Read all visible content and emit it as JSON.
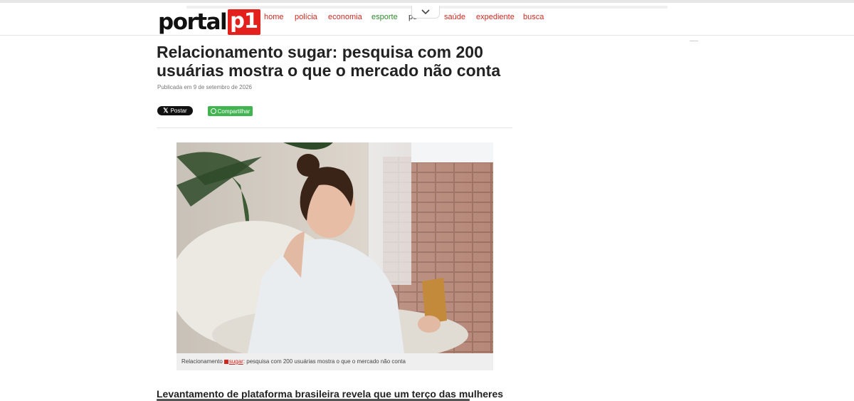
{
  "logo": {
    "text": "portal",
    "box": "p1"
  },
  "nav": {
    "home": "home",
    "policia": "polícia",
    "economia": "economia",
    "esporte": "esporte",
    "politica": "po",
    "saude": "saúde",
    "expediente": "expediente",
    "busca": "busca"
  },
  "article": {
    "headline": "Relacionamento sugar: pesquisa com 200 usuárias mostra o que o mercado não conta",
    "pubdate": "Publicada em 9 de setembro de 2026",
    "share_x": "Postar",
    "share_wa": "Compartilhar",
    "caption_pre": "Relacionamento",
    "caption_tag": "sugar",
    "caption_post": ": pesquisa com 200 usuárias mostra o que o mercado não conta",
    "lede": "Levantamento de plataforma brasileira revela que um terço das mulheres"
  },
  "colors": {
    "brand_red": "#e3201b",
    "link_red": "#d4261f",
    "esporte_green": "#2e8b2e",
    "whatsapp_green": "#3fb44f"
  },
  "icons": [
    "x-logo-icon",
    "whatsapp-icon",
    "chevron-down-icon",
    "flag-icon"
  ]
}
